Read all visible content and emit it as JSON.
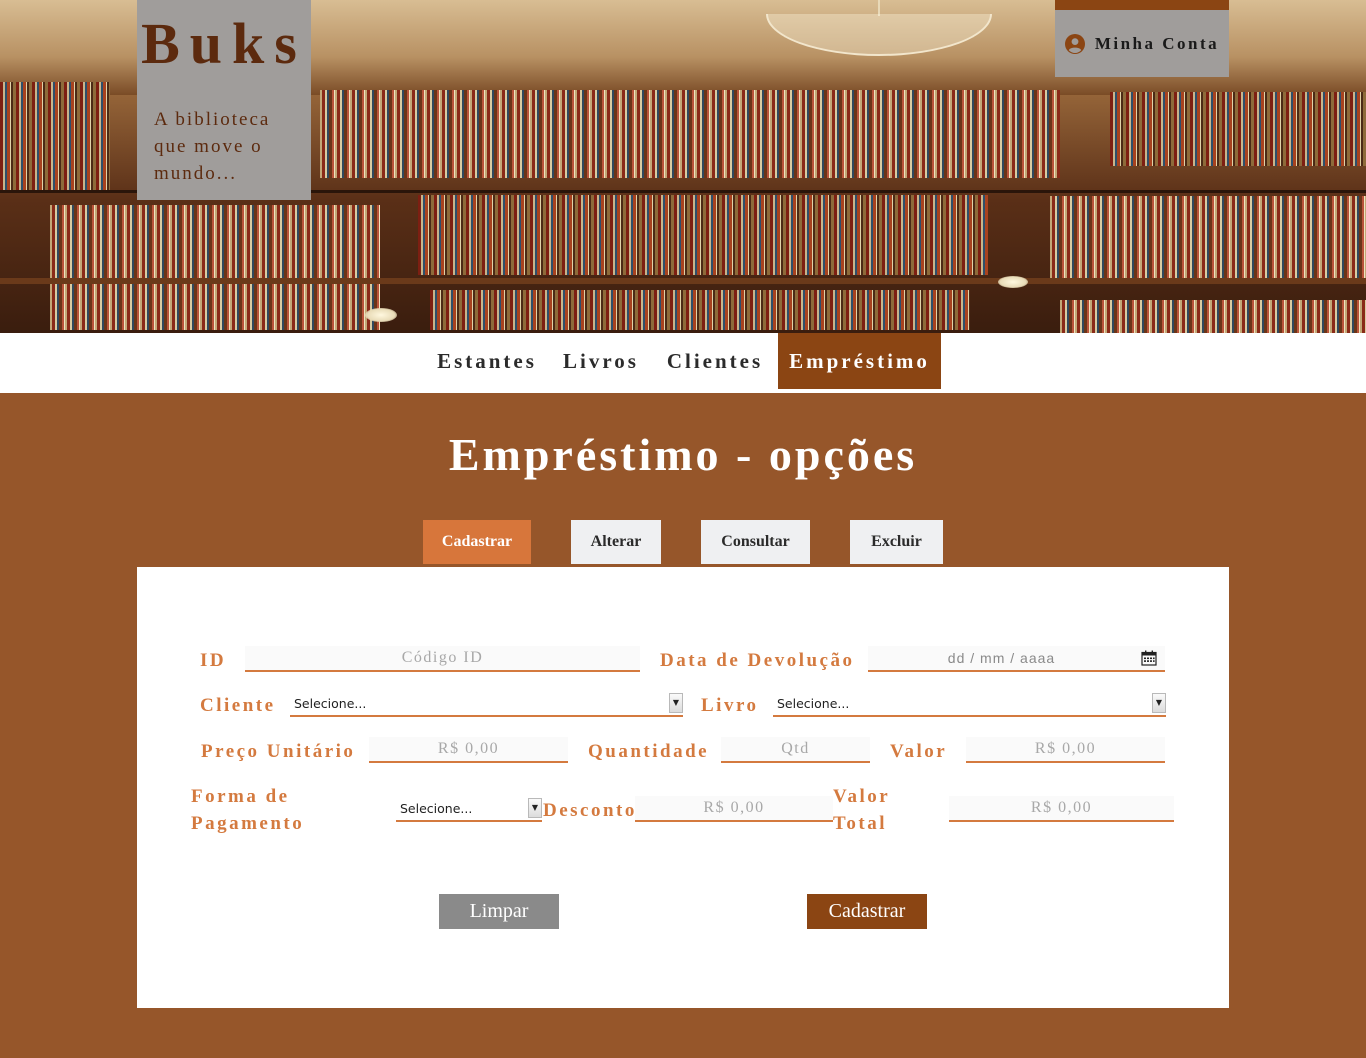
{
  "brand": {
    "title": "Buks",
    "tagline": "A biblioteca que move o mundo..."
  },
  "account": {
    "label": "Minha Conta",
    "icon": "user-circle-icon"
  },
  "nav": {
    "items": [
      "Estantes",
      "Livros",
      "Clientes",
      "Empréstimo"
    ],
    "active": "Empréstimo"
  },
  "page": {
    "title": "Empréstimo - opções"
  },
  "tabs": {
    "items": [
      "Cadastrar",
      "Alterar",
      "Consultar",
      "Excluir"
    ],
    "active": "Cadastrar"
  },
  "form": {
    "id": {
      "label": "ID",
      "placeholder": "Código ID"
    },
    "return_date": {
      "label": "Data de Devolução",
      "placeholder": "dd / mm / aaaa"
    },
    "client": {
      "label": "Cliente",
      "value": "Selecione..."
    },
    "book": {
      "label": "Livro",
      "value": "Selecione..."
    },
    "unit_price": {
      "label": "Preço Unitário",
      "placeholder": "R$ 0,00"
    },
    "quantity": {
      "label": "Quantidade",
      "placeholder": "Qtd"
    },
    "value": {
      "label": "Valor",
      "placeholder": "R$ 0,00"
    },
    "payment": {
      "label": "Forma de Pagamento",
      "value": "Selecione..."
    },
    "discount": {
      "label": "Desconto",
      "placeholder": "R$ 0,00"
    },
    "total": {
      "label": "Valor Total",
      "placeholder": "R$ 0,00"
    },
    "clear_label": "Limpar",
    "submit_label": "Cadastrar"
  },
  "colors": {
    "accent": "#d47a3f",
    "brown": "#8b4513",
    "background": "#96562a",
    "tab_active": "#d7763b"
  }
}
